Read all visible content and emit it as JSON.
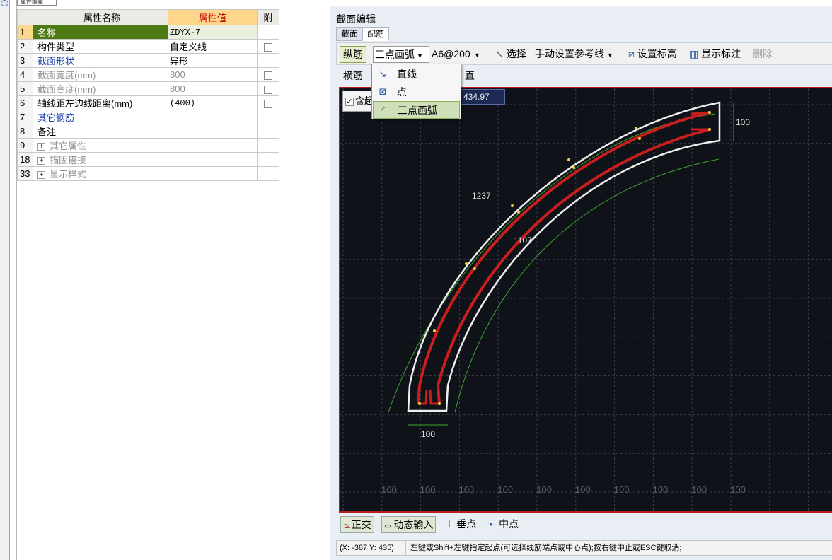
{
  "properties_tab": "属性编辑",
  "table": {
    "col_name": "属性名称",
    "col_value": "属性值",
    "col_attach": "附",
    "rows": [
      {
        "num": "1",
        "name": "名称",
        "value": "ZDYX-7",
        "style": "sel",
        "check": false
      },
      {
        "num": "2",
        "name": "构件类型",
        "value": "自定义线",
        "style": "",
        "check": true
      },
      {
        "num": "3",
        "name": "截面形状",
        "value": "异形",
        "style": "blue",
        "check": false
      },
      {
        "num": "4",
        "name": "截面宽度(mm)",
        "value": "800",
        "style": "gray",
        "check": true
      },
      {
        "num": "5",
        "name": "截面高度(mm)",
        "value": "800",
        "style": "gray",
        "check": true
      },
      {
        "num": "6",
        "name": "轴线距左边线距离(mm)",
        "value": "(400)",
        "style": "",
        "check": true
      },
      {
        "num": "7",
        "name": "其它钢筋",
        "value": "",
        "style": "blue",
        "check": false
      },
      {
        "num": "8",
        "name": "备注",
        "value": "",
        "style": "",
        "check": false
      },
      {
        "num": "9",
        "name": "其它属性",
        "value": "",
        "style": "gray plus",
        "check": false
      },
      {
        "num": "18",
        "name": "锚固搭接",
        "value": "",
        "style": "gray plus",
        "check": false
      },
      {
        "num": "33",
        "name": "显示样式",
        "value": "",
        "style": "gray plus",
        "check": false
      }
    ]
  },
  "dialog": {
    "title": "截面编辑",
    "tabs": [
      "截面",
      "配筋"
    ],
    "active_tab": "配筋",
    "toolbar": {
      "zongjin": "纵筋",
      "draw_mode": "三点画弧",
      "spec": "A6@200",
      "select": "选择",
      "ref_line": "手动设置参考线",
      "set_elev": "设置标高",
      "show_dim": "显示标注",
      "delete": "删除"
    },
    "toolbar2": {
      "hengjin": "横筋",
      "partial": "直"
    },
    "menu": [
      {
        "label": "直线",
        "icon": "line-icon"
      },
      {
        "label": "点",
        "icon": "point-icon"
      },
      {
        "label": "三点画弧",
        "icon": "arc-icon"
      }
    ],
    "canvas": {
      "checkbox_label": "含起",
      "coord_value": "434.97",
      "dims": {
        "top_right": "100",
        "outer_len": "1237",
        "inner_len": "1107",
        "bottom": "100"
      },
      "ruler": [
        "100",
        "100",
        "100",
        "100",
        "100",
        "100",
        "100",
        "100",
        "100",
        "100"
      ]
    },
    "bottom": {
      "ortho": "正交",
      "dynamic": "动态输入",
      "perp": "垂点",
      "mid": "中点"
    },
    "status": {
      "coord": "(X: -387 Y: 435)",
      "message": "左键或Shift+左键指定起点(可选择线筋端点或中心点);按右键中止或ESC键取消;"
    }
  },
  "colors": {
    "accent_green": "#4d7a12",
    "header_orange": "#fdd68c",
    "rebar_red": "#c81e1e",
    "canvas_bg": "#0f1218"
  }
}
